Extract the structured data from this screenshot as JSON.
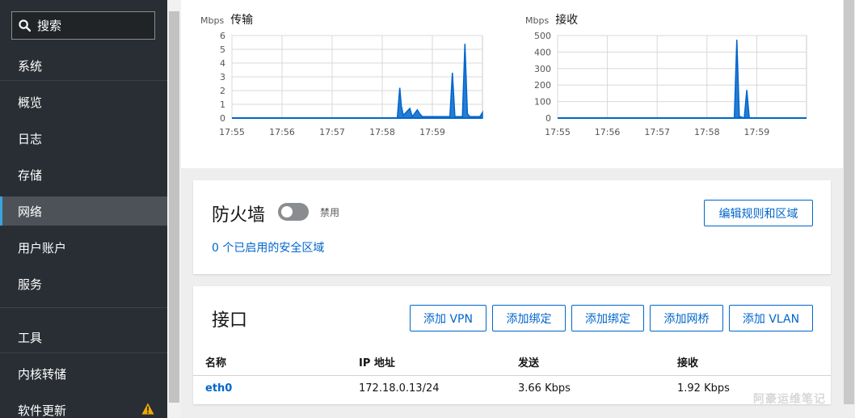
{
  "sidebar": {
    "search_label": "搜索",
    "items": [
      {
        "label": "系统"
      },
      {
        "label": "概览"
      },
      {
        "label": "日志"
      },
      {
        "label": "存储"
      },
      {
        "label": "网络",
        "active": true
      },
      {
        "label": "用户账户"
      },
      {
        "label": "服务"
      },
      {
        "label": "工具"
      },
      {
        "label": "内核转储"
      },
      {
        "label": "软件更新",
        "icon": "warning-icon"
      }
    ]
  },
  "graphs": {
    "transmit": {
      "unit": "Mbps",
      "title": "传输",
      "y_ticks": [
        "6",
        "5",
        "4",
        "3",
        "2",
        "1",
        "0"
      ],
      "x_ticks": [
        "17:55",
        "17:56",
        "17:57",
        "17:58",
        "17:59"
      ]
    },
    "receive": {
      "unit": "Mbps",
      "title": "接收",
      "y_ticks": [
        "500",
        "400",
        "300",
        "200",
        "100",
        "0"
      ],
      "x_ticks": [
        "17:55",
        "17:56",
        "17:57",
        "17:58",
        "17:59"
      ]
    }
  },
  "chart_data": [
    {
      "type": "area",
      "title": "传输",
      "ylabel": "Mbps",
      "ylim": [
        0,
        6
      ],
      "x_ticks": [
        "17:55",
        "17:56",
        "17:57",
        "17:58",
        "17:59"
      ],
      "points": [
        [
          0,
          0
        ],
        [
          3.3,
          0
        ],
        [
          3.35,
          2.2
        ],
        [
          3.38,
          0.9
        ],
        [
          3.42,
          0.2
        ],
        [
          3.55,
          0.7
        ],
        [
          3.6,
          0.1
        ],
        [
          3.7,
          0.6
        ],
        [
          3.75,
          0.3
        ],
        [
          3.8,
          0.1
        ],
        [
          4.35,
          0.1
        ],
        [
          4.4,
          3.3
        ],
        [
          4.45,
          0.1
        ],
        [
          4.6,
          0.1
        ],
        [
          4.65,
          5.4
        ],
        [
          4.7,
          0.3
        ],
        [
          4.75,
          0.1
        ],
        [
          4.95,
          0.1
        ],
        [
          5.0,
          0.4
        ]
      ],
      "color": "#0066cc"
    },
    {
      "type": "area",
      "title": "接收",
      "ylabel": "Mbps",
      "ylim": [
        0,
        500
      ],
      "x_ticks": [
        "17:55",
        "17:56",
        "17:57",
        "17:58",
        "17:59"
      ],
      "points": [
        [
          0,
          0
        ],
        [
          3.55,
          0
        ],
        [
          3.6,
          475
        ],
        [
          3.65,
          10
        ],
        [
          3.75,
          0
        ],
        [
          3.8,
          170
        ],
        [
          3.85,
          0
        ],
        [
          5.0,
          0
        ]
      ],
      "color": "#0066cc"
    }
  ],
  "firewall": {
    "title": "防火墙",
    "toggle_state": "禁用",
    "zones_link": "0 个已启用的安全区域",
    "edit_button": "编辑规则和区域"
  },
  "interfaces": {
    "title": "接口",
    "buttons": [
      "添加 VPN",
      "添加绑定",
      "添加绑定",
      "添加网桥",
      "添加 VLAN"
    ],
    "columns": [
      "名称",
      "IP 地址",
      "发送",
      "接收"
    ],
    "rows": [
      {
        "name": "eth0",
        "ip": "172.18.0.13/24",
        "send": "3.66 Kbps",
        "recv": "1.92 Kbps"
      }
    ]
  },
  "watermark": "阿豪运维笔记",
  "colors": {
    "accent": "#0066cc",
    "sidebar_bg": "#292e34",
    "active_bar": "#39a5dc",
    "warning": "#f0ab00"
  }
}
